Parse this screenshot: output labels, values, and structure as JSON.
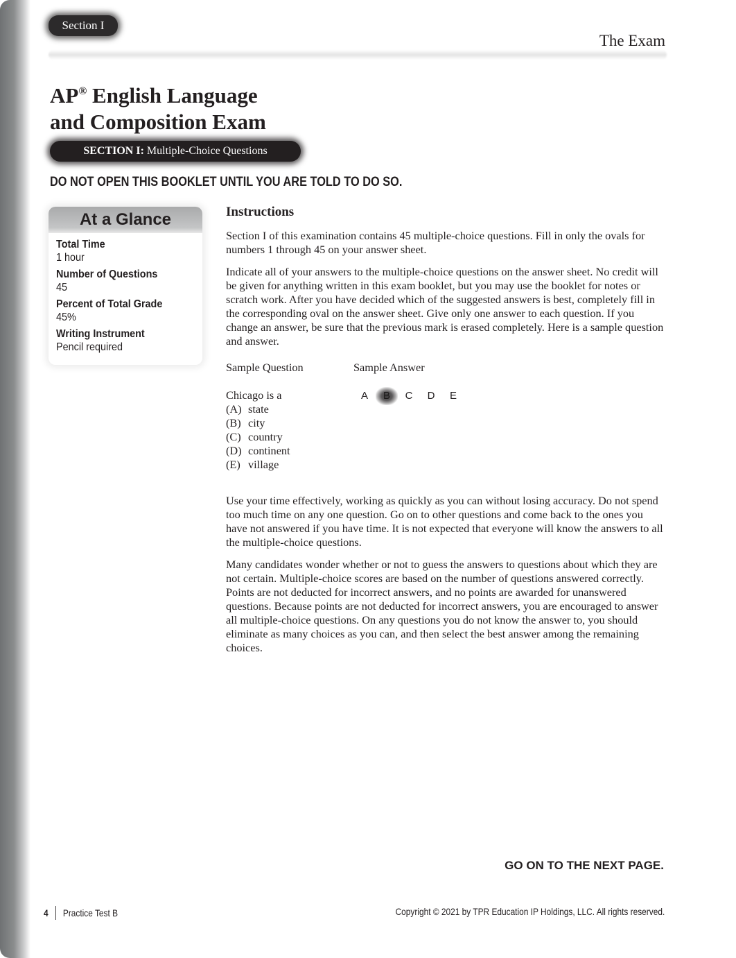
{
  "header": {
    "section_tab": "Section I",
    "running_head": "The Exam"
  },
  "title": {
    "line1_prefix": "AP",
    "registered_mark": "®",
    "line1_suffix": " English Language",
    "line2": "and Composition Exam"
  },
  "section_bar": {
    "bold": "SECTION I:",
    "text": " Multiple-Choice Questions"
  },
  "warning": "DO NOT OPEN THIS BOOKLET UNTIL YOU ARE TOLD TO DO SO.",
  "at_a_glance": {
    "title": "At a Glance",
    "items": [
      {
        "label": "Total Time",
        "value": "1 hour"
      },
      {
        "label": "Number of Questions",
        "value": "45"
      },
      {
        "label": "Percent of Total Grade",
        "value": "45%"
      },
      {
        "label": "Writing Instrument",
        "value": "Pencil required"
      }
    ]
  },
  "instructions": {
    "heading": "Instructions",
    "paragraphs": [
      "Section I of this examination contains 45 multiple-choice questions. Fill in only the ovals for numbers 1 through 45 on your answer sheet.",
      "Indicate all of your answers to the multiple-choice questions on the answer sheet. No credit will be given for anything written in this exam booklet, but you may use the booklet for notes or scratch work. After you have decided which of the suggested answers is best, completely fill in the corresponding oval on the answer sheet. Give only one answer to each question. If you change an answer, be sure that the previous mark is erased completely. Here is a sample question and answer.",
      "Use your time effectively, working as quickly as you can without losing accuracy. Do not spend too much time on any one question. Go on to other questions and come back to the ones you have not answered if you have time. It is not expected that everyone will know the answers to all the multiple-choice questions.",
      "Many candidates wonder whether or not to guess the answers to questions about which they are not certain. Multiple-choice scores are based on the number of questions answered correctly. Points are not deducted for incorrect answers, and no points are awarded for unanswered questions. Because points are not deducted for incorrect answers, you are encouraged to answer all multiple-choice questions. On any questions you do not know the answer to, you should eliminate as many choices as you can, and then select the best answer among the remaining choices."
    ]
  },
  "sample": {
    "question_label": "Sample Question",
    "answer_label": "Sample Answer",
    "stem": "Chicago is a",
    "choices": [
      {
        "letter": "(A)",
        "text": "state"
      },
      {
        "letter": "(B)",
        "text": "city"
      },
      {
        "letter": "(C)",
        "text": "country"
      },
      {
        "letter": "(D)",
        "text": "continent"
      },
      {
        "letter": "(E)",
        "text": "village"
      }
    ],
    "bubbles": [
      "A",
      "B",
      "C",
      "D",
      "E"
    ],
    "selected": "B"
  },
  "footer": {
    "go_on": "GO ON TO THE NEXT PAGE.",
    "page_number": "4",
    "book_title": "Practice Test B",
    "copyright": "Copyright © 2021 by TPR Education IP Holdings, LLC. All rights reserved."
  }
}
